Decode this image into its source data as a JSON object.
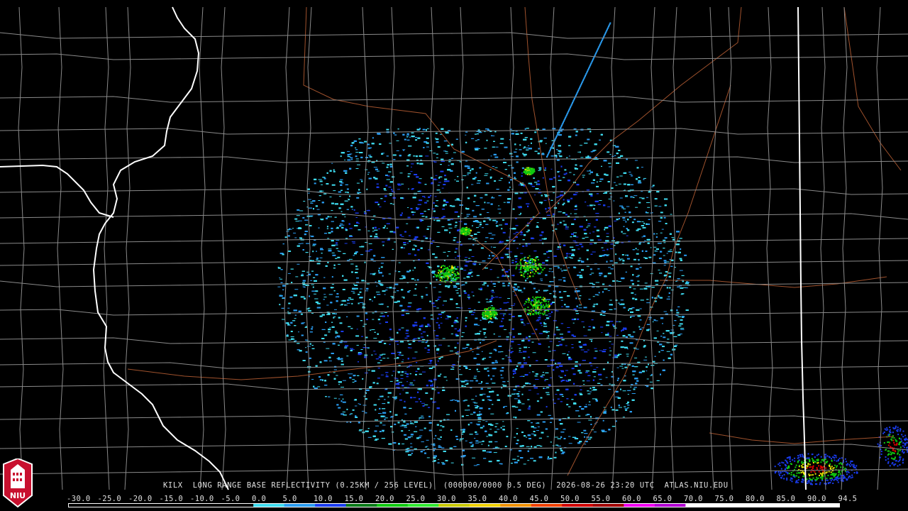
{
  "caption": {
    "station": "KILX",
    "product": "LONG RANGE BASE REFLECTIVITY (0.25KM / 256 LEVEL)",
    "volume": "(000000/0000 0.5 DEG)",
    "datetime": "2026-08-26 23:20 UTC",
    "source": "ATLAS.NIU.EDU"
  },
  "scale": {
    "labels": [
      "-30.0",
      "-25.0",
      "-20.0",
      "-15.0",
      "-10.0",
      "-5.0",
      "0.0",
      "5.0",
      "10.0",
      "15.0",
      "20.0",
      "25.0",
      "30.0",
      "35.0",
      "40.0",
      "45.0",
      "50.0",
      "55.0",
      "60.0",
      "65.0",
      "70.0",
      "75.0",
      "80.0",
      "85.0",
      "90.0",
      "94.5"
    ],
    "colors": [
      "#000000",
      "#000000",
      "#000000",
      "#000000",
      "#000000",
      "#000000",
      "#3fdcf0",
      "#2a9cf0",
      "#1a3cf0",
      "#0a7a18",
      "#10c810",
      "#30e830",
      "#c8c800",
      "#f0d000",
      "#f09000",
      "#f04000",
      "#d00000",
      "#a00000",
      "#f000f0",
      "#b000d0",
      "#ffffff",
      "#ffffff",
      "#ffffff",
      "#ffffff",
      "#ffffff"
    ]
  },
  "logo": {
    "text": "NIU",
    "color": "#c8102e"
  },
  "map_colors": {
    "background": "#000000",
    "county_lines": "#8a8a8a",
    "state_lines": "#ffffff",
    "highways": "#a0522d",
    "echo_light": "#3fdcf0",
    "echo_mid": "#2a9cf0",
    "echo_deep": "#1a3cf0",
    "echo_green": "#10c810",
    "echo_yellow": "#e8e800",
    "echo_red": "#e00000"
  }
}
